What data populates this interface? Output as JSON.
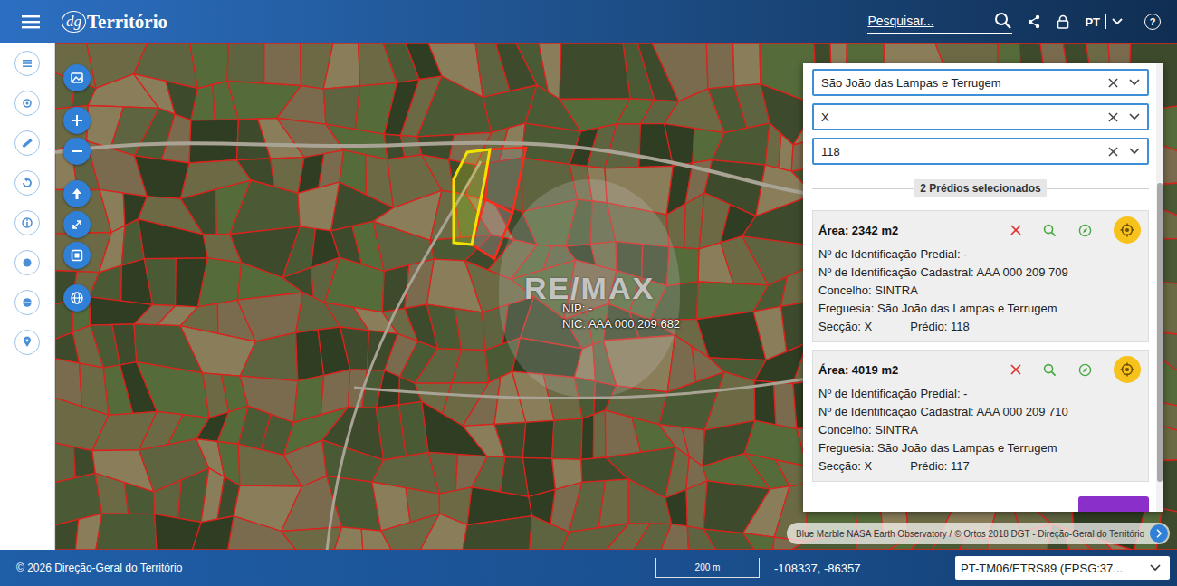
{
  "header": {
    "logo_mark": "dg",
    "logo_name": "Território",
    "search_placeholder": "Pesquisar...",
    "language": "PT",
    "help": "?"
  },
  "map": {
    "watermark": "RE/MAX",
    "parcel_label": [
      "NIP: -",
      "NIC: AAA 000 209 682"
    ],
    "attribution": "Blue Marble NASA Earth Observatory / © Ortos 2018 DGT - Direção-Geral do Território"
  },
  "panel": {
    "filters": [
      {
        "value": "São João das Lampas e Terrugem"
      },
      {
        "value": "X"
      },
      {
        "value": "118"
      }
    ],
    "selection_count": "2 Prédios selecionados",
    "results": [
      {
        "area": "Área: 2342 m2",
        "lines": [
          [
            "Nº de Identificação Predial: -"
          ],
          [
            "Nº de Identificação Cadastral: AAA 000 209 709"
          ],
          [
            "Concelho: SINTRA"
          ],
          [
            "Freguesia: São João das Lampas e Terrugem"
          ],
          [
            "Secção: X",
            "Prédio: 118"
          ]
        ]
      },
      {
        "area": "Área: 4019 m2",
        "lines": [
          [
            "Nº de Identificação Predial: -"
          ],
          [
            "Nº de Identificação Cadastral: AAA 000 209 710"
          ],
          [
            "Concelho: SINTRA"
          ],
          [
            "Freguesia: São João das Lampas e Terrugem"
          ],
          [
            "Secção: X",
            "Prédio: 117"
          ]
        ]
      }
    ]
  },
  "status_bar": {
    "copyright": "© 2026 Direção-Geral do Território",
    "scale": "200 m",
    "coordinates": "-108337, -86357",
    "projection": "PT-TM06/ETRS89 (EPSG:37..."
  }
}
